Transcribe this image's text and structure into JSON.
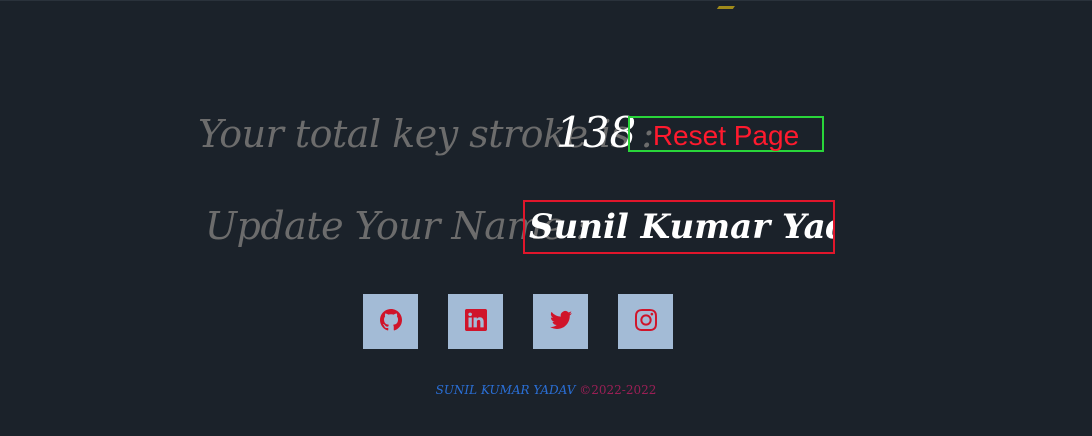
{
  "keystroke": {
    "label": "Your total key stroke is :",
    "count": "138",
    "reset_label": "Reset Page"
  },
  "name": {
    "label": "Update Your Name :",
    "value": "Sunil Kumar Yadav"
  },
  "socials": [
    {
      "name": "github",
      "icon": "github-icon"
    },
    {
      "name": "linkedin",
      "icon": "linkedin-icon"
    },
    {
      "name": "twitter",
      "icon": "twitter-icon"
    },
    {
      "name": "instagram",
      "icon": "instagram-icon"
    }
  ],
  "footer": {
    "author": "SUNIL KUMAR YADAV",
    "copyright": "©2022-2022"
  },
  "colors": {
    "background": "#1b222a",
    "label": "#6c6c6c",
    "reset_border": "#29d63a",
    "reset_text": "#ff1a2e",
    "input_border": "#e0162b",
    "social_bg": "#a3bbd6",
    "social_icon": "#d0142a",
    "footer_name": "#2a6fd6",
    "footer_copy": "#9a1f55"
  }
}
